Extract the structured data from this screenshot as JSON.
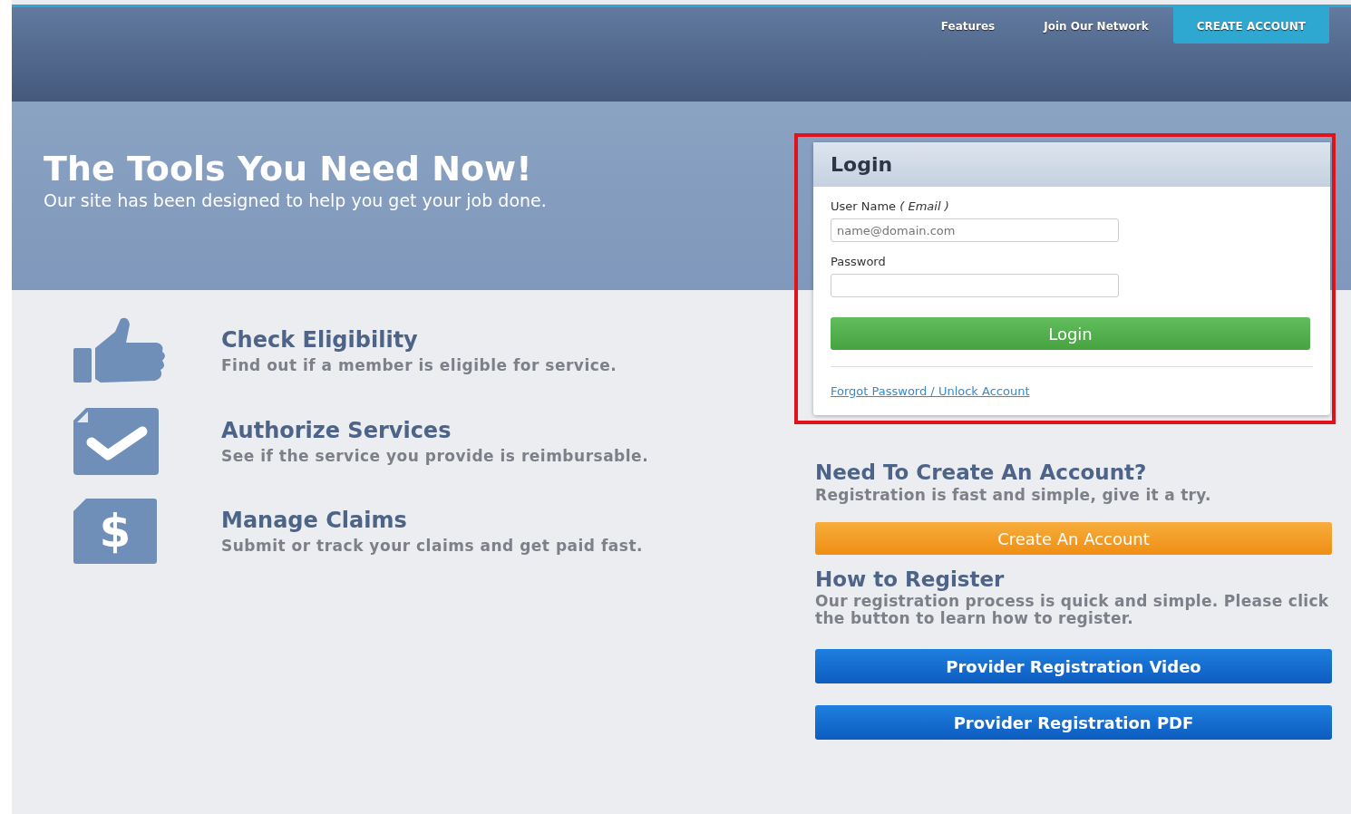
{
  "nav": {
    "links": [
      {
        "label": "Features",
        "kind": "link"
      },
      {
        "label": "Join Our Network",
        "kind": "link"
      },
      {
        "label": "CREATE ACCOUNT",
        "kind": "button"
      }
    ]
  },
  "hero": {
    "title": "The Tools You Need Now!",
    "subtitle": "Our site has been designed to help you get your job done."
  },
  "features": [
    {
      "kind": "thumb",
      "title": "Check Eligibility",
      "text": "Find out if a member is eligible for service."
    },
    {
      "kind": "check",
      "title": "Authorize Services",
      "text": "See if the service you provide is reimbursable."
    },
    {
      "kind": "dollar",
      "icon_text": "$",
      "title": "Manage Claims",
      "text": "Submit or track your claims and get paid fast."
    }
  ],
  "login": {
    "title": "Login",
    "highlighted": true,
    "username_label": "User Name",
    "username_hint": "( Email )",
    "username_placeholder": "name@domain.com",
    "password_label": "Password",
    "button": "Login",
    "link": "Forgot Password / Unlock Account"
  },
  "create": {
    "title": "Need To Create An Account?",
    "text": "Registration is fast and simple, give it a try.",
    "button": "Create An Account"
  },
  "register": {
    "title": "How to Register",
    "text": "Our registration process is quick and simple. Please click the button to learn how to register.",
    "buttons": [
      "Provider Registration Video",
      "Provider Registration PDF"
    ]
  }
}
